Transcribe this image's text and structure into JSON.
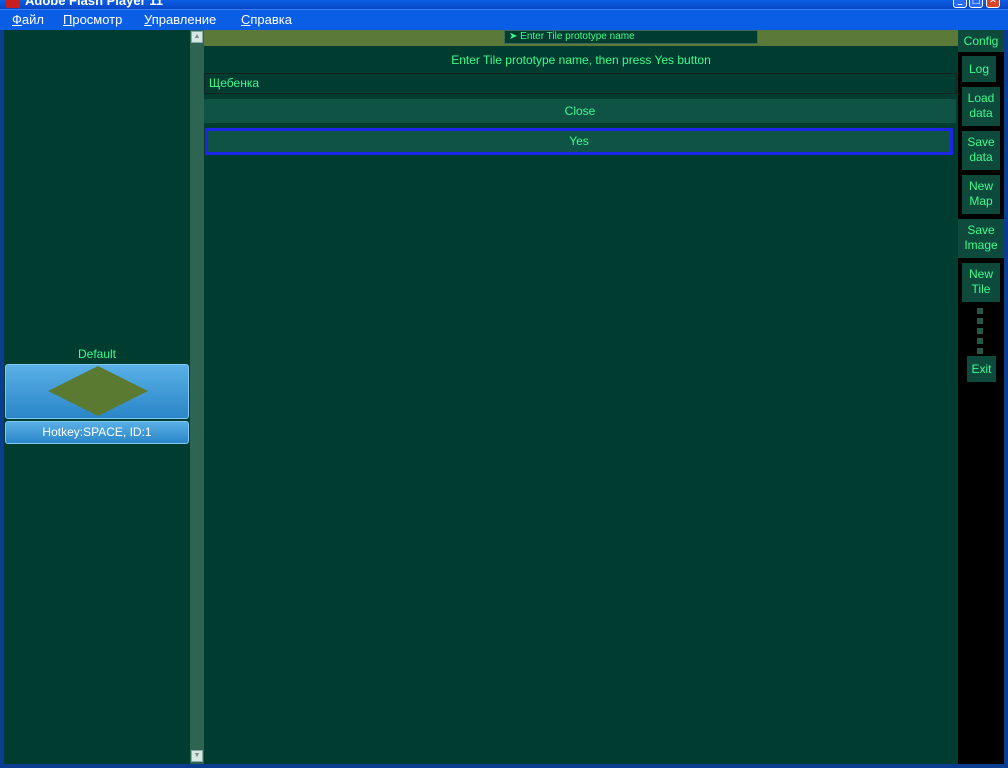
{
  "window": {
    "title": "Adobe Flash Player 11",
    "controls": [
      "_",
      "□",
      "✕"
    ]
  },
  "menu": [
    "Файл",
    "Просмотр",
    "Управление",
    "Справка"
  ],
  "left_panel": {
    "tile_name": "Default",
    "hotkey_text": "Hotkey:SPACE, ID:1",
    "scroll_up": "▲",
    "scroll_down": "▼"
  },
  "dialog": {
    "tooltip": "➤ Enter Tile prototype name",
    "prompt": "Enter Tile prototype name, then press Yes button",
    "input_value": "Щебенка",
    "close_label": "Close",
    "yes_label": "Yes"
  },
  "toolbar": {
    "config": "Config",
    "log": "Log",
    "load_data_1": "Load",
    "load_data_2": "data",
    "save_data_1": "Save",
    "save_data_2": "data",
    "new_map_1": "New",
    "new_map_2": "Map",
    "save_image_1": "Save",
    "save_image_2": "Image",
    "new_tile_1": "New",
    "new_tile_2": "Tile",
    "exit": "Exit"
  },
  "colors": {
    "background": "#003d30",
    "text": "#3dfc8c",
    "button": "#0f5345",
    "focus_border": "#1e26e6",
    "tile_card": "#3a96d4",
    "tile_diamond": "#5a7a32"
  }
}
